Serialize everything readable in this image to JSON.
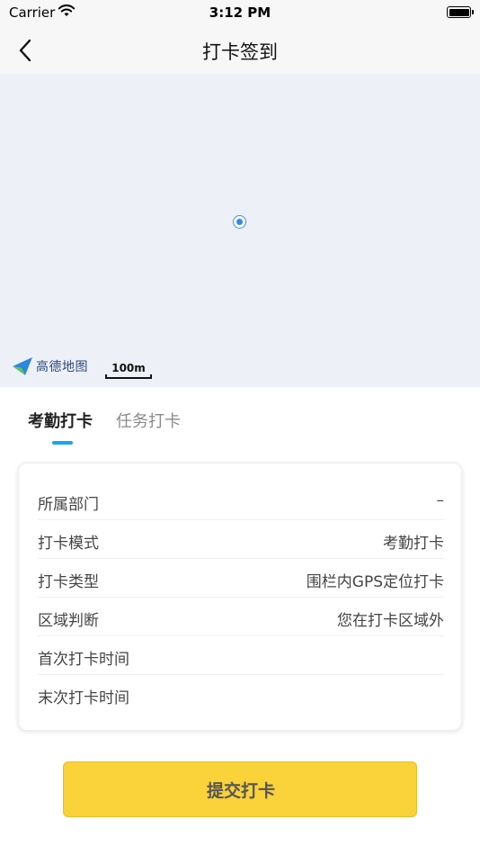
{
  "status_bar": {
    "carrier": "Carrier",
    "time": "3:12 PM"
  },
  "nav": {
    "title": "打卡签到"
  },
  "map": {
    "provider_logo_text": "高德地图",
    "scale_label": "100m"
  },
  "tabs": [
    {
      "label": "考勤打卡",
      "active": true
    },
    {
      "label": "任务打卡",
      "active": false
    }
  ],
  "info_card": {
    "rows": [
      {
        "label": "所属部门",
        "value": "–"
      },
      {
        "label": "打卡模式",
        "value": "考勤打卡"
      },
      {
        "label": "打卡类型",
        "value": "围栏内GPS定位打卡"
      },
      {
        "label": "区域判断",
        "value": "您在打卡区域外"
      },
      {
        "label": "首次打卡时间",
        "value": ""
      },
      {
        "label": "末次打卡时间",
        "value": ""
      }
    ]
  },
  "submit_button": {
    "label": "提交打卡"
  },
  "colors": {
    "accent_blue": "#1aa3f0",
    "submit_yellow": "#fad23a",
    "map_background": "#eef0f8"
  }
}
